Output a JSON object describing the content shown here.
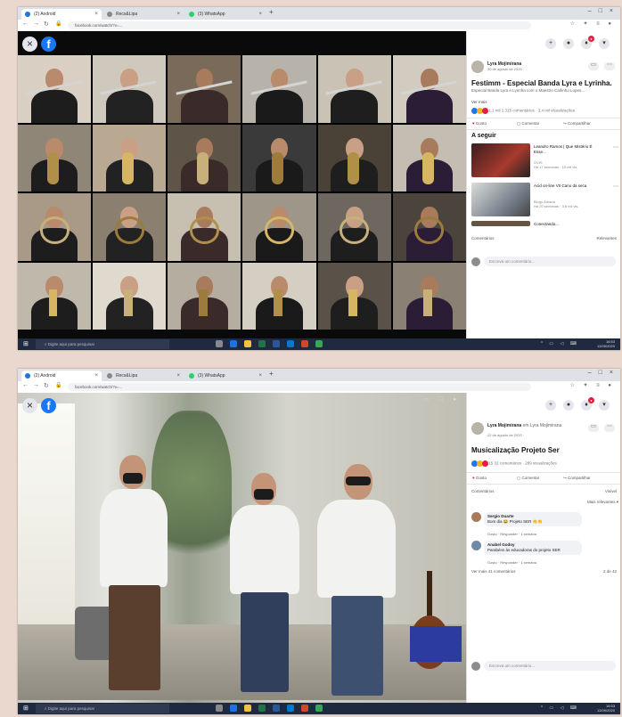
{
  "top": {
    "tabs": [
      {
        "label": "(2) Android",
        "active": true
      },
      {
        "label": "Recs&Lipa",
        "active": false
      },
      {
        "label": "(3) WhatsApp",
        "active": false
      }
    ],
    "url": "facebook.com/watch/?v=...",
    "post": {
      "author": "Lyra Mojimirana",
      "meta": "30 de agosto de 2020 ·",
      "title": "Festimm - Especial Banda Lyra e Lyrinha.",
      "desc": "Especial Banda Lyra e Lyrinha com o Maestro Carlinho Lopes...",
      "more": "Ver mais",
      "reactions": "1,1 mil   1.315 comentários · 3,4 mil visualizações",
      "actions": [
        "Gosto",
        "Comentar",
        "Compartilhar"
      ]
    },
    "up_next_title": "A seguir",
    "suggestions": [
      {
        "title": "Leandro Ramos | Que Mistério É Esse...",
        "meta": "OVIS",
        "meta2": "Há 17 semanas · 15 mil vis."
      },
      {
        "title": "Acid on-line VII Cano da seca",
        "meta": "Bingo Amaral",
        "meta2": "Há 20 semanas · 3,8 mil vis."
      },
      {
        "title": "Conectando...",
        "meta": "",
        "meta2": ""
      }
    ],
    "comments_label": "Comentários",
    "comments_filter": "Relevantes",
    "comment_placeholder": "Escreva um comentário..."
  },
  "bottom": {
    "tabs": [
      {
        "label": "(2) Android",
        "active": true
      },
      {
        "label": "Recs&Lipa",
        "active": false
      },
      {
        "label": "(3) WhatsApp",
        "active": false
      }
    ],
    "url": "facebook.com/watch/?v=...",
    "post": {
      "author": "Lyra Mojimirana",
      "author_extra": "em Lyra Mojimirana",
      "meta": "22 de agosto de 2020 ·",
      "title": "Musicalização Projeto Ser",
      "reactions": "15   32 comentários · 289 visualizações",
      "actions": [
        "Gosto",
        "Comentar",
        "Compartilhar"
      ]
    },
    "comments_label": "Comentários",
    "comments_filter": "Visível",
    "comments_more": "Mais relevantes",
    "comments": [
      {
        "name": "Sergio Duarte",
        "text": "Bom dia 😂 Projeto SER 👏👏",
        "actions": "Gosto · Responder · 1 semana"
      },
      {
        "name": "Anabel Godoy",
        "text": "Parabéns às educadoras do projeto SER",
        "actions": "Gosto · Responder · 1 semana"
      }
    ],
    "see_more": "Ver mais 41 comentários",
    "see_more_count": "2 de 42",
    "comment_placeholder": "Escreva um comentário..."
  },
  "taskbar": {
    "search": "Digite aqui para pesquisar",
    "time_top": "16:53",
    "date_top": "12/09/2020",
    "time_bottom": "16:53",
    "date_bottom": "12/09/2020"
  },
  "icons": {
    "close": "close-icon",
    "facebook": "facebook-logo-icon",
    "windows": "windows-start-icon",
    "search": "search-icon"
  },
  "colors": {
    "facebook_blue": "#1877f2",
    "notification_red": "#e41e3f",
    "taskbar": "#1f2a40",
    "page_bg": "#ead8ce"
  }
}
